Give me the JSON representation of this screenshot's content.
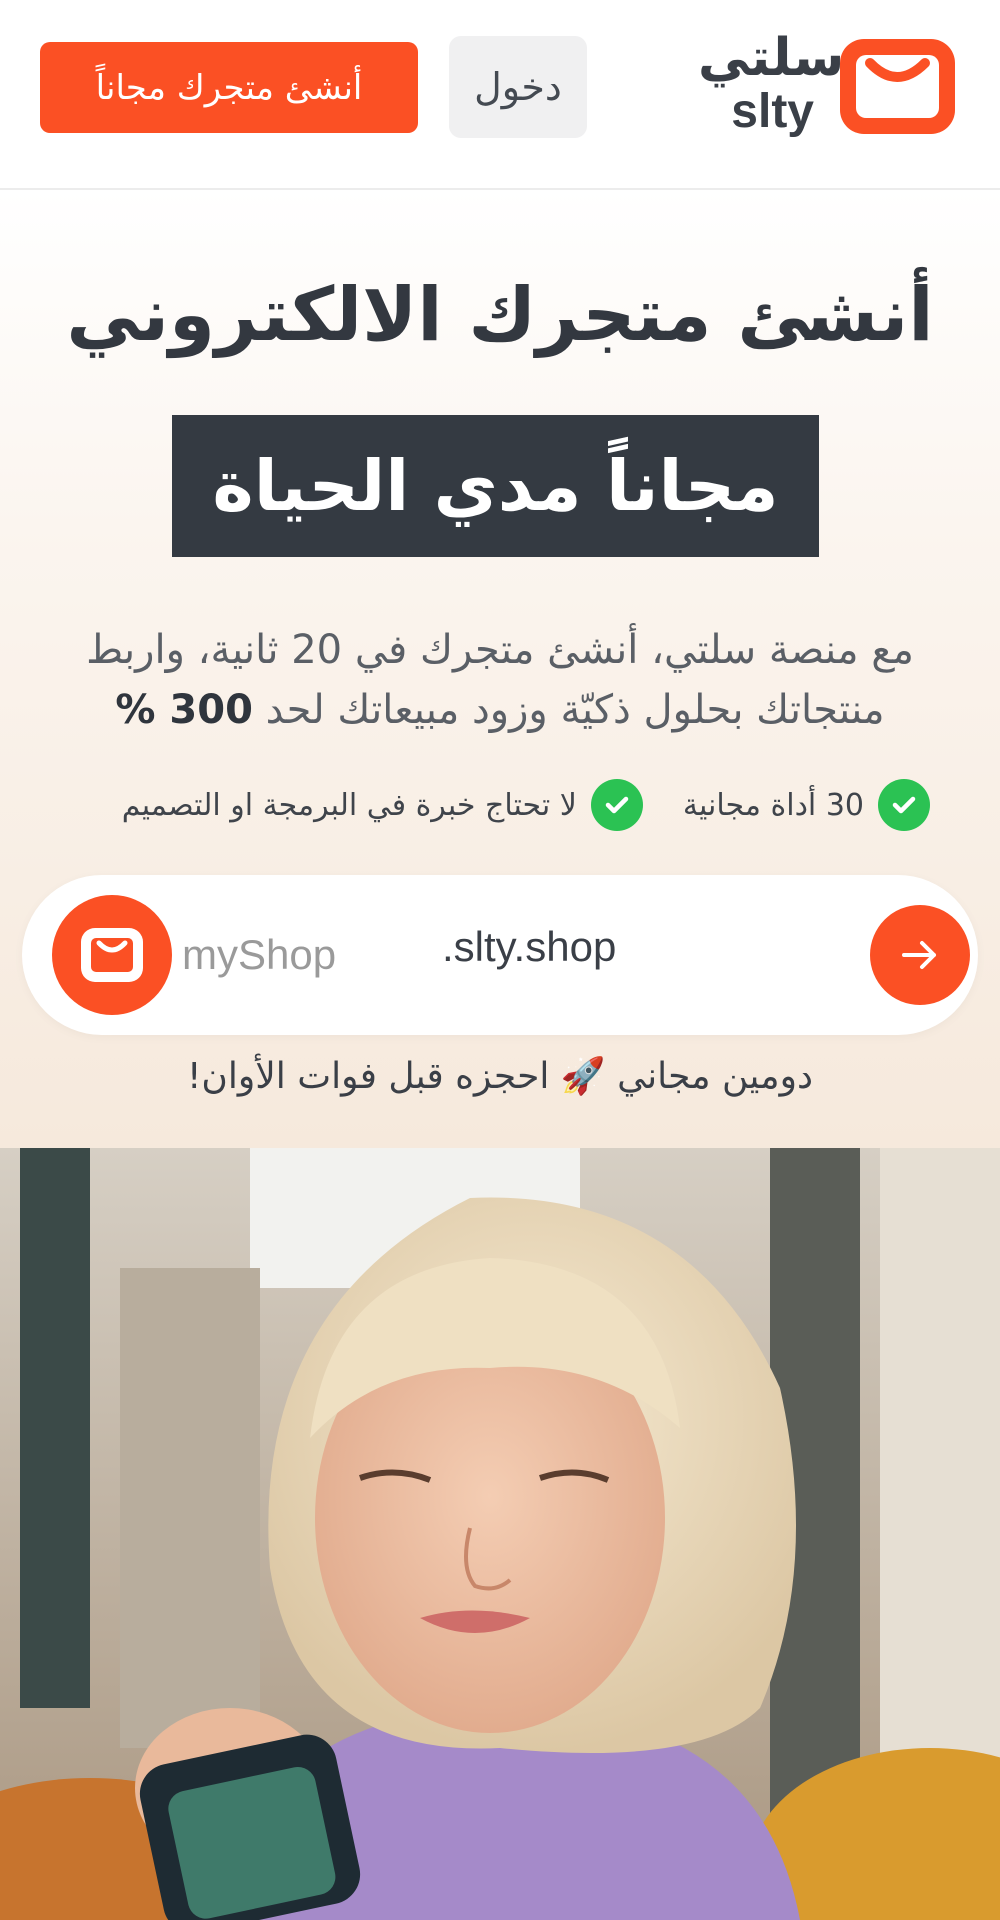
{
  "header": {
    "logo_ar": "سلتي",
    "logo_en": "slty",
    "login_label": "دخول",
    "cta_label": "أنشئ متجرك مجاناً"
  },
  "hero": {
    "title": "أنشئ متجرك الالكتروني",
    "highlight": "مجاناً مدي الحياة",
    "desc_line1": "مع منصة سلتي، أنشئ متجرك في 20 ثانية، واربط",
    "desc_line2_prefix": "منتجاتك بحلول ذكيّة وزود مبيعاتك لحد",
    "desc_line2_bold": "300 %",
    "features": [
      {
        "label": "30 أداة مجانية"
      },
      {
        "label": "لا تحتاج خبرة في البرمجة او التصميم"
      }
    ]
  },
  "domain": {
    "placeholder": "myShop",
    "suffix": ".slty.shop",
    "note": "دومين مجاني 🚀 احجزه قبل فوات الأوان!"
  },
  "colors": {
    "brand": "#fb5024",
    "dark": "#343a42",
    "check": "#2bc253"
  }
}
